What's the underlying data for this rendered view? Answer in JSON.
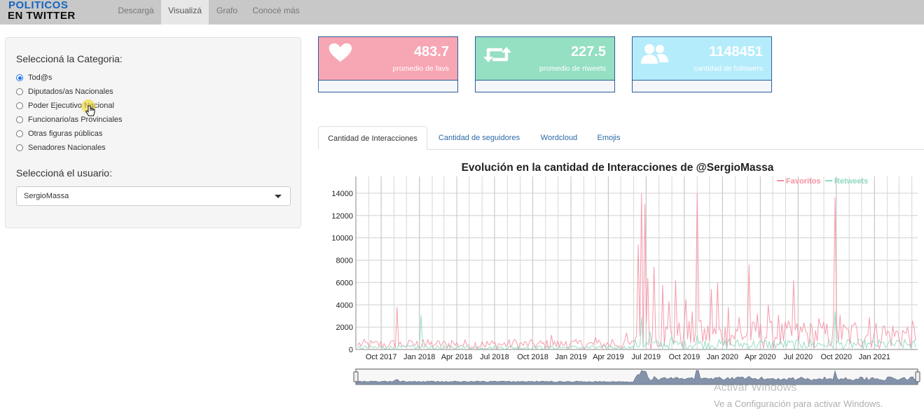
{
  "brand": {
    "line1": "POLITICOS",
    "line2": "EN TWITTER"
  },
  "nav": {
    "tabs": [
      "Descargá",
      "Visualizá",
      "Grafo",
      "Conocé más"
    ],
    "active": "Visualizá"
  },
  "sidebar": {
    "category_label": "Seleccioná la Categoria:",
    "categories": [
      "Tod@s",
      "Diputados/as Nacionales",
      "Poder Ejecutivo Nacional",
      "Funcionario/as Provinciales",
      "Otras figuras públicas",
      "Senadores Nacionales"
    ],
    "selected_category": "Tod@s",
    "user_label": "Seleccioná el usuario:",
    "user_value": "SergioMassa"
  },
  "value_boxes": [
    {
      "value": "483.7",
      "subtitle": "promedio de favs",
      "icon": "heart-icon",
      "color": "#f7a6b4"
    },
    {
      "value": "227.5",
      "subtitle": "promedio de rtweets",
      "icon": "retweet-icon",
      "color": "#95dfc3"
    },
    {
      "value": "1148451",
      "subtitle": "cantidad de followers",
      "icon": "users-icon",
      "color": "#b5ecfb"
    }
  ],
  "tabs": {
    "items": [
      "Cantidad de Interacciones",
      "Cantidad de seguidores",
      "Wordcloud",
      "Emojis"
    ],
    "active": "Cantidad de Interacciones"
  },
  "chart_data": {
    "type": "line",
    "title": "Evolución en la cantidad de Interacciones de @SergioMassa",
    "xlabel": "",
    "ylabel": "",
    "x_ticks": [
      "Oct 2017",
      "Jan 2018",
      "Apr 2018",
      "Jul 2018",
      "Oct 2018",
      "Jan 2019",
      "Apr 2019",
      "Jul 2019",
      "Oct 2019",
      "Jan 2020",
      "Apr 2020",
      "Jul 2020",
      "Oct 2020",
      "Jan 2021"
    ],
    "y_ticks": [
      0,
      2000,
      4000,
      6000,
      8000,
      10000,
      12000,
      14000
    ],
    "ylim": [
      0,
      15500
    ],
    "xlim": [
      "2017-08-01",
      "2021-04-15"
    ],
    "grid": true,
    "legend_placement": "top-right",
    "range_slider": true,
    "series": [
      {
        "name": "Favoritos",
        "color": "#f490a2",
        "points": [
          [
            "2017-08-05",
            350
          ],
          [
            "2017-09-10",
            600
          ],
          [
            "2017-10-20",
            400
          ],
          [
            "2017-11-08",
            3800
          ],
          [
            "2017-11-20",
            300
          ],
          [
            "2017-12-15",
            700
          ],
          [
            "2018-01-10",
            900
          ],
          [
            "2018-02-10",
            500
          ],
          [
            "2018-03-20",
            800
          ],
          [
            "2018-04-25",
            400
          ],
          [
            "2018-06-01",
            700
          ],
          [
            "2018-07-10",
            500
          ],
          [
            "2018-08-20",
            900
          ],
          [
            "2018-10-01",
            600
          ],
          [
            "2018-11-15",
            1300
          ],
          [
            "2018-12-20",
            700
          ],
          [
            "2019-01-25",
            800
          ],
          [
            "2019-03-01",
            1100
          ],
          [
            "2019-04-10",
            900
          ],
          [
            "2019-05-15",
            1500
          ],
          [
            "2019-06-12",
            9400
          ],
          [
            "2019-06-20",
            14000
          ],
          [
            "2019-06-28",
            13000
          ],
          [
            "2019-07-05",
            6400
          ],
          [
            "2019-07-20",
            7400
          ],
          [
            "2019-08-10",
            5800
          ],
          [
            "2019-08-25",
            4300
          ],
          [
            "2019-09-10",
            6200
          ],
          [
            "2019-10-05",
            4500
          ],
          [
            "2019-10-20",
            3400
          ],
          [
            "2019-11-01",
            14000
          ],
          [
            "2019-11-10",
            2600
          ],
          [
            "2019-12-05",
            5400
          ],
          [
            "2019-12-20",
            6000
          ],
          [
            "2020-01-15",
            3800
          ],
          [
            "2020-02-10",
            2900
          ],
          [
            "2020-03-05",
            7600
          ],
          [
            "2020-03-25",
            3200
          ],
          [
            "2020-04-20",
            4000
          ],
          [
            "2020-05-15",
            3100
          ],
          [
            "2020-06-20",
            6200
          ],
          [
            "2020-07-15",
            2400
          ],
          [
            "2020-08-20",
            2800
          ],
          [
            "2020-09-28",
            13600
          ],
          [
            "2020-10-10",
            3100
          ],
          [
            "2020-11-15",
            2400
          ],
          [
            "2020-12-20",
            2900
          ],
          [
            "2021-01-25",
            2100
          ],
          [
            "2021-03-10",
            1700
          ],
          [
            "2021-04-10",
            800
          ]
        ]
      },
      {
        "name": "Retweets",
        "color": "#8fd9bf",
        "points": [
          [
            "2017-08-05",
            150
          ],
          [
            "2017-10-01",
            250
          ],
          [
            "2017-12-15",
            400
          ],
          [
            "2018-01-05",
            3100
          ],
          [
            "2018-01-28",
            300
          ],
          [
            "2018-04-01",
            200
          ],
          [
            "2018-07-01",
            200
          ],
          [
            "2018-10-01",
            200
          ],
          [
            "2019-01-01",
            250
          ],
          [
            "2019-04-01",
            300
          ],
          [
            "2019-06-20",
            2900
          ],
          [
            "2019-07-10",
            1600
          ],
          [
            "2019-09-01",
            1200
          ],
          [
            "2019-11-01",
            1300
          ],
          [
            "2020-01-15",
            900
          ],
          [
            "2020-04-15",
            800
          ],
          [
            "2020-07-15",
            700
          ],
          [
            "2020-09-28",
            3400
          ],
          [
            "2020-12-20",
            500
          ],
          [
            "2021-04-10",
            200
          ]
        ]
      }
    ]
  },
  "watermark": {
    "line1": "Activar Windows",
    "line2": "Ve a Configuración para activar Windows."
  }
}
